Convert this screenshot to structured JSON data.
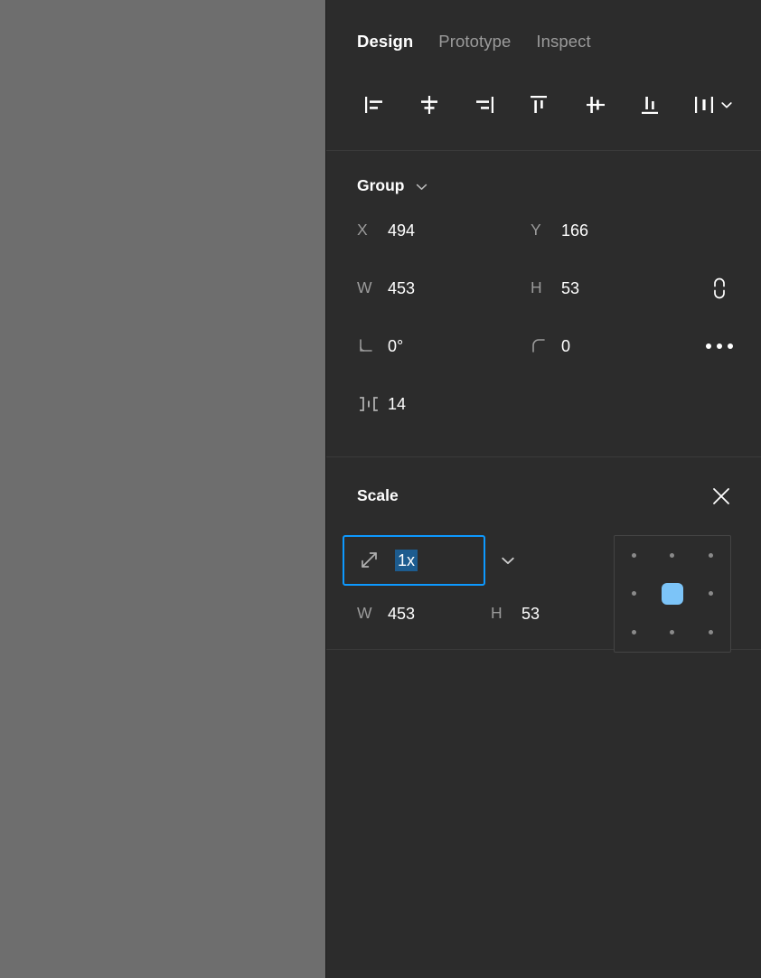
{
  "theme": {
    "canvas_bg": "#6e6e6e",
    "panel_bg": "#2c2c2c",
    "divider": "#3a3a3a",
    "text_primary": "#ffffff",
    "text_muted": "#9b9b9b",
    "accent_focus": "#0d99ff",
    "accent_selection": "#1d5c8f",
    "accent_anchor": "#7cc4f8"
  },
  "tabs": [
    {
      "label": "Design",
      "active": true
    },
    {
      "label": "Prototype",
      "active": false
    },
    {
      "label": "Inspect",
      "active": false
    }
  ],
  "align_toolbar": [
    {
      "name": "align-left",
      "tooltip": "Align left"
    },
    {
      "name": "align-horizontal-centers",
      "tooltip": "Align horizontal centers"
    },
    {
      "name": "align-right",
      "tooltip": "Align right"
    },
    {
      "name": "align-top",
      "tooltip": "Align top"
    },
    {
      "name": "align-vertical-centers",
      "tooltip": "Align vertical centers"
    },
    {
      "name": "align-bottom",
      "tooltip": "Align bottom"
    },
    {
      "name": "distribute",
      "tooltip": "Tidy up"
    }
  ],
  "group": {
    "title": "Group",
    "chevron_icon": "chevron-down-icon",
    "x": {
      "label": "X",
      "value": "494"
    },
    "y": {
      "label": "Y",
      "value": "166"
    },
    "w": {
      "label": "W",
      "value": "453"
    },
    "h": {
      "label": "H",
      "value": "53"
    },
    "rotation": {
      "icon": "angle-icon",
      "value": "0°"
    },
    "corner_radius": {
      "icon": "corner-radius-icon",
      "value": "0"
    },
    "spacing": {
      "icon": "horizontal-spacing-icon",
      "value": "14"
    },
    "constrain_proportions": {
      "icon": "broken-link-icon",
      "linked": false
    },
    "more_options": {
      "icon": "ellipsis-icon"
    }
  },
  "scale": {
    "title": "Scale",
    "close_icon": "close-icon",
    "input": {
      "icon": "scale-diagonal-arrow-icon",
      "value": "1x",
      "placeholder": "1x",
      "selected": true,
      "focused": true
    },
    "dropdown_icon": "chevron-down-icon",
    "w": {
      "label": "W",
      "value": "453"
    },
    "h": {
      "label": "H",
      "value": "53"
    },
    "anchor": {
      "name": "scale-anchor-grid",
      "selected_index": 4,
      "cells": [
        "top-left",
        "top-center",
        "top-right",
        "middle-left",
        "center",
        "middle-right",
        "bottom-left",
        "bottom-center",
        "bottom-right"
      ]
    }
  }
}
